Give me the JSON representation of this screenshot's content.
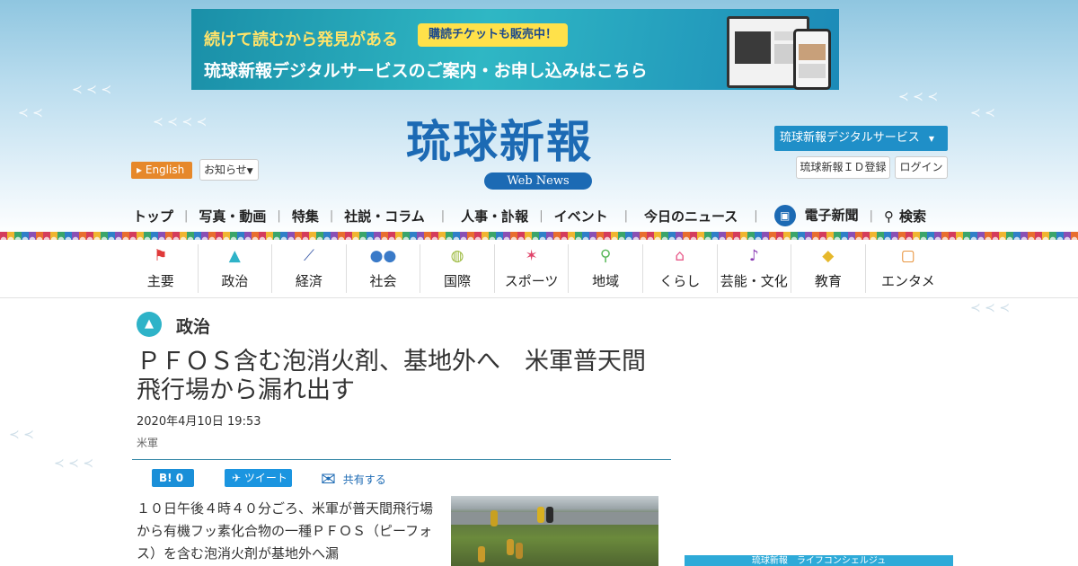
{
  "banner": {
    "line1": "続けて読むから発見がある",
    "ticket": "購読チケットも販売中！",
    "line2": "琉球新報デジタルサービスのご案内・お申し込みはこちら"
  },
  "header": {
    "logo_text": "琉球新報",
    "logo_badge": "Web News",
    "english_label": "English",
    "notice_label": "お知らせ",
    "digital_service_label": "琉球新報デジタルサービス",
    "id_register_label": "琉球新報ＩＤ登録",
    "login_label": "ログイン"
  },
  "topnav": {
    "items": [
      "トップ",
      "写真・動画",
      "特集",
      "社説・コラム",
      "人事・訃報",
      "イベント",
      "今日のニュース",
      "電子新聞",
      "検索"
    ]
  },
  "catnav": {
    "items": [
      {
        "label": "主要",
        "icon": "flag-icon",
        "color": "#e03a3a"
      },
      {
        "label": "政治",
        "icon": "parliament-icon",
        "color": "#2eb3c8"
      },
      {
        "label": "経済",
        "icon": "chart-icon",
        "color": "#3a5aa8"
      },
      {
        "label": "社会",
        "icon": "people-icon",
        "color": "#3a7ac8"
      },
      {
        "label": "国際",
        "icon": "globe-icon",
        "color": "#9ab83a"
      },
      {
        "label": "スポーツ",
        "icon": "runner-icon",
        "color": "#e0446a"
      },
      {
        "label": "地域",
        "icon": "pin-icon",
        "color": "#5ab85a"
      },
      {
        "label": "くらし",
        "icon": "house-icon",
        "color": "#e85a8a"
      },
      {
        "label": "芸能・文化",
        "icon": "sanshin-icon",
        "color": "#8a3ab4"
      },
      {
        "label": "教育",
        "icon": "graduation-cap-icon",
        "color": "#e6b82b"
      },
      {
        "label": "エンタメ",
        "icon": "tv-icon",
        "color": "#e68a2b"
      }
    ]
  },
  "article": {
    "section": "政治",
    "headline": "ＰＦＯＳ含む泡消火剤、基地外へ　米軍普天間飛行場から漏れ出す",
    "date": "2020年4月10日 19:53",
    "tag": "米軍",
    "hatena_label": "B! 0",
    "tweet_label": "ツイート",
    "share_label": "共有する",
    "body": "１０日午後４時４０分ごろ、米軍が普天間飛行場から有機フッ素化合物の一種ＰＦＯＳ（ピーフォス）を含む泡消火剤が基地外へ漏"
  },
  "sidebar": {
    "banner_text": "琉球新報　ライフコンシェルジュ"
  }
}
